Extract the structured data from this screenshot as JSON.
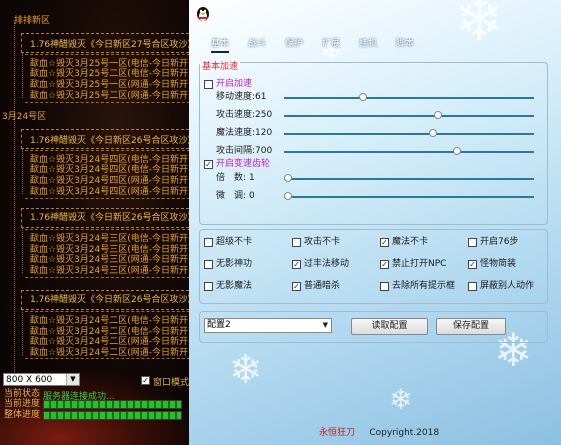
{
  "launcher": {
    "tree": [
      {
        "id": "g1",
        "text": "排排新区",
        "type": "head"
      },
      {
        "id": "s1",
        "text": "1.76神醋毁灭《今日新区27号合区攻沙》",
        "type": "server"
      },
      {
        "id": "r1",
        "text": "歃血☆毁灭3月25号一区(电信-今日新开",
        "type": "line"
      },
      {
        "id": "r2",
        "text": "歃血☆毁灭3月25号二区(电信-今日新开",
        "type": "line"
      },
      {
        "id": "r3",
        "text": "歃血☆毁灭3月25号一区(网通-今日新开",
        "type": "line"
      },
      {
        "id": "r4",
        "text": "歃血☆毁灭3月25号二区(网通-今日新开",
        "type": "line"
      },
      {
        "id": "g2",
        "text": "3月24号区",
        "type": "head"
      },
      {
        "id": "s2",
        "text": "1.76神醋毁灭《今日新区26号合区攻沙》",
        "type": "server"
      },
      {
        "id": "r5",
        "text": "歃血☆毁灭3月24号四区(电信-今日新开",
        "type": "line"
      },
      {
        "id": "r6",
        "text": "歃血☆毁灭3月24号四区(电信-今日新开",
        "type": "line"
      },
      {
        "id": "r7",
        "text": "歃血☆毁灭3月24号四区(网通-今日新开",
        "type": "line"
      },
      {
        "id": "r8",
        "text": "歃血☆毁灭3月24号四区(网通-今日新开",
        "type": "line"
      },
      {
        "id": "s3",
        "text": "1.76神醋毁灭《今日新区26号合区攻沙》",
        "type": "server"
      },
      {
        "id": "r9",
        "text": "歃血☆毁灭3月24号三区(电信-今日新开",
        "type": "line"
      },
      {
        "id": "r10",
        "text": "歃血☆毁灭3月24号三区(电信-今日新开",
        "type": "line"
      },
      {
        "id": "r11",
        "text": "歃血☆毁灭3月24号三区(网通-今日新开",
        "type": "line"
      },
      {
        "id": "r12",
        "text": "歃血☆毁灭3月24号三区(网通-今日新开",
        "type": "line"
      },
      {
        "id": "s4",
        "text": "1.76神醋毁灭《今日新区26号合区攻沙》",
        "type": "server"
      },
      {
        "id": "r13",
        "text": "歃血☆毁灭3月24号二区(电信-今日新开",
        "type": "line"
      },
      {
        "id": "r14",
        "text": "歃血☆毁灭3月24号二区(电信-今日新开",
        "type": "line"
      },
      {
        "id": "r15",
        "text": "歃血☆毁灭3月24号二区(网通-今日新开",
        "type": "line"
      },
      {
        "id": "r16",
        "text": "歃血☆毁灭3月24号二区(网通-今日新开",
        "type": "line"
      }
    ],
    "resolution": "800 X 600",
    "window_mode_label": "窗口模式",
    "window_mode_checked": true,
    "status_label": "当前状态",
    "status_value": "服务器连接成功...",
    "progress_current_label": "当前进度",
    "progress_total_label": "整体进度",
    "progress_current": 1.0,
    "progress_total": 1.0,
    "progress_current_pct": "100%",
    "progress_total_pct": "100%"
  },
  "tool": {
    "tabs": [
      "基本",
      "战斗",
      "保护",
      "扩展",
      "挂机",
      "脚本"
    ],
    "active_tab": 0,
    "panel_title": "基本加速",
    "speed": {
      "enable_label": "开启加速",
      "enable_checked": false,
      "sliders": [
        {
          "label": "移动速度:",
          "value": "61",
          "level": 0.31
        },
        {
          "label": "攻击速度:",
          "value": "250",
          "level": 0.62
        },
        {
          "label": "魔法速度:",
          "value": "120",
          "level": 0.6
        },
        {
          "label": "攻击间隔:",
          "value": "700",
          "level": 0.7
        }
      ],
      "gear_label": "开启变速齿轮",
      "gear_checked": true,
      "gear_sliders": [
        {
          "label": "倍",
          "label2": "数:",
          "value": "1",
          "level": 0.0
        },
        {
          "label": "微",
          "label2": "调:",
          "value": "0",
          "level": 0.0
        }
      ]
    },
    "options": [
      {
        "label": "超级不卡",
        "checked": false
      },
      {
        "label": "攻击不卡",
        "checked": false
      },
      {
        "label": "魔法不卡",
        "checked": true
      },
      {
        "label": "开启76步",
        "checked": false
      },
      {
        "label": "无影神功",
        "checked": false
      },
      {
        "label": "过丰法移动",
        "checked": true
      },
      {
        "label": "禁止打开NPC",
        "checked": true
      },
      {
        "label": "怪物简装",
        "checked": true
      },
      {
        "label": "无影魔法",
        "checked": false
      },
      {
        "label": "普通暗杀",
        "checked": true
      },
      {
        "label": "去除所有提示框",
        "checked": false
      },
      {
        "label": "屏蔽别人动作",
        "checked": false
      }
    ],
    "config_value": "配置2",
    "read_config_label": "读取配置",
    "save_config_label": "保存配置",
    "footer_brand": "永恒狂刀",
    "footer_copyright": "Copyright.2018",
    "colors": {
      "accent_red": "#e4243c",
      "magenta": "#c21ec8",
      "slider_track": "#2a7a96",
      "check_mark": "#1a2c9a"
    }
  }
}
